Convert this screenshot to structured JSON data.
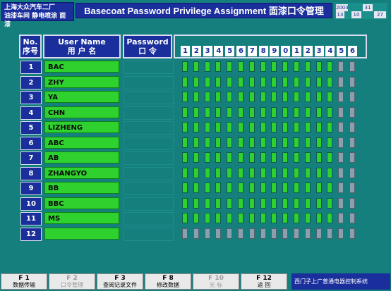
{
  "header": {
    "org_line1": "上海大众汽车二厂",
    "org_line2": "油漆车间 静电喷涂 面漆",
    "title": "Basecoat Password Privilege Assignment 面漆口令管理",
    "date": {
      "year": "2004",
      "day": "31",
      "month": "10",
      "h": "13",
      "m": "27",
      "s": ""
    }
  },
  "columns": {
    "no_en": "No.",
    "no_cn": "序号",
    "user_en": "User Name",
    "user_cn": "用 户 名",
    "pwd_en": "Password",
    "pwd_cn": "口 令",
    "bits": [
      "1",
      "2",
      "3",
      "4",
      "5",
      "6",
      "7",
      "8",
      "9",
      "0",
      "1",
      "2",
      "3",
      "4",
      "5",
      "6"
    ]
  },
  "rows": [
    {
      "no": "1",
      "name": "BAC",
      "bits": [
        1,
        1,
        1,
        1,
        1,
        1,
        1,
        1,
        1,
        1,
        1,
        1,
        1,
        1,
        0,
        0
      ]
    },
    {
      "no": "2",
      "name": "ZHY",
      "bits": [
        1,
        1,
        1,
        1,
        1,
        1,
        1,
        1,
        1,
        1,
        1,
        1,
        1,
        1,
        0,
        0
      ]
    },
    {
      "no": "3",
      "name": "YA",
      "bits": [
        1,
        1,
        1,
        1,
        1,
        1,
        1,
        1,
        1,
        1,
        1,
        1,
        1,
        1,
        0,
        0
      ]
    },
    {
      "no": "4",
      "name": "CHN",
      "bits": [
        1,
        1,
        1,
        1,
        1,
        1,
        1,
        1,
        1,
        1,
        1,
        1,
        1,
        1,
        0,
        0
      ]
    },
    {
      "no": "5",
      "name": "LIZHENG",
      "bits": [
        1,
        1,
        1,
        1,
        1,
        1,
        1,
        1,
        1,
        1,
        1,
        1,
        1,
        1,
        0,
        0
      ]
    },
    {
      "no": "6",
      "name": "ABC",
      "bits": [
        1,
        1,
        1,
        1,
        1,
        1,
        1,
        1,
        1,
        1,
        1,
        1,
        1,
        1,
        0,
        0
      ]
    },
    {
      "no": "7",
      "name": "AB",
      "bits": [
        1,
        1,
        1,
        1,
        1,
        1,
        1,
        1,
        1,
        1,
        1,
        1,
        1,
        1,
        0,
        0
      ]
    },
    {
      "no": "8",
      "name": "ZHANGYO",
      "bits": [
        1,
        1,
        1,
        1,
        1,
        1,
        1,
        1,
        1,
        1,
        1,
        1,
        1,
        1,
        0,
        0
      ]
    },
    {
      "no": "9",
      "name": "BB",
      "bits": [
        1,
        1,
        1,
        1,
        1,
        1,
        1,
        1,
        1,
        1,
        1,
        1,
        1,
        1,
        0,
        0
      ]
    },
    {
      "no": "10",
      "name": "BBC",
      "bits": [
        1,
        1,
        1,
        1,
        1,
        1,
        1,
        1,
        1,
        1,
        1,
        1,
        1,
        1,
        0,
        0
      ]
    },
    {
      "no": "11",
      "name": "MS",
      "bits": [
        1,
        1,
        1,
        1,
        1,
        1,
        1,
        1,
        1,
        1,
        1,
        1,
        1,
        1,
        0,
        0
      ]
    },
    {
      "no": "12",
      "name": "",
      "bits": [
        0,
        0,
        0,
        0,
        0,
        0,
        0,
        0,
        0,
        0,
        0,
        0,
        0,
        0,
        0,
        0
      ]
    }
  ],
  "fkeys": [
    {
      "key": "F 1",
      "label": "数据传输",
      "enabled": true
    },
    {
      "key": "F 2",
      "label": "口令管理",
      "enabled": false
    },
    {
      "key": "F 3",
      "label": "查阅记录文件",
      "enabled": true
    },
    {
      "key": "F 8",
      "label": "修改数据",
      "enabled": true
    },
    {
      "key": "F 10",
      "label": "光 标",
      "enabled": false
    },
    {
      "key": "F 12",
      "label": "返 回",
      "enabled": true
    }
  ],
  "footer_brand": "西门子上广普通电器控制系统"
}
